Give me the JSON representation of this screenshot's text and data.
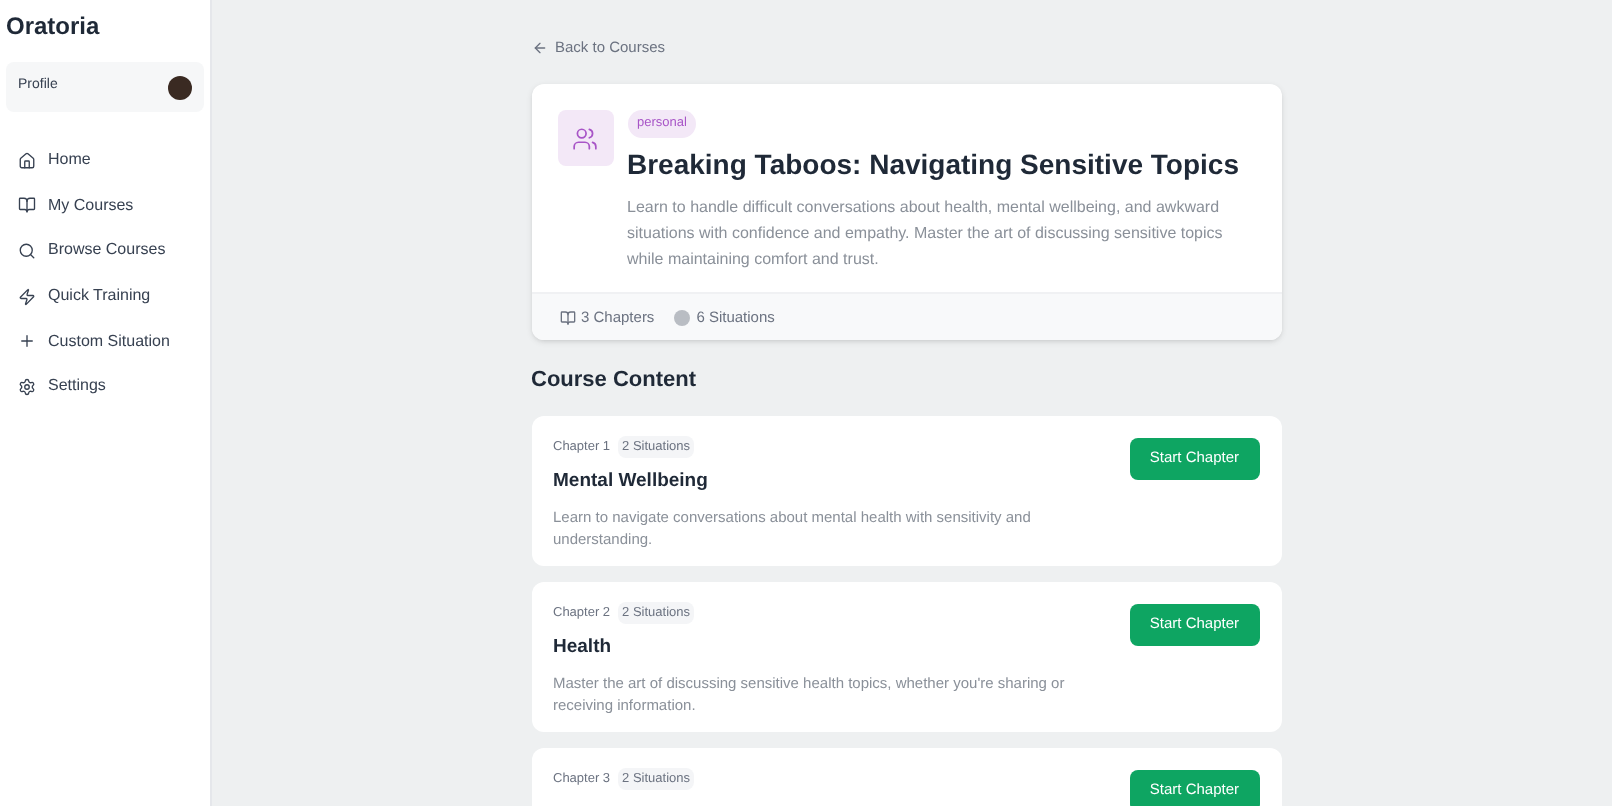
{
  "sidebar": {
    "brand": "Oratoria",
    "profile": {
      "label": "Profile"
    },
    "items": [
      {
        "label": "Home"
      },
      {
        "label": "My Courses"
      },
      {
        "label": "Browse Courses"
      },
      {
        "label": "Quick Training"
      },
      {
        "label": "Custom Situation"
      },
      {
        "label": "Settings"
      }
    ]
  },
  "back_link": "Back to Courses",
  "course": {
    "tag": "personal",
    "title": "Breaking Taboos: Navigating Sensitive Topics",
    "description": "Learn to handle difficult conversations about health, mental wellbeing, and awkward situations with confidence and empathy. Master the art of discussing sensitive topics while maintaining comfort and trust.",
    "chapters": "3 Chapters",
    "situations": "6 Situations"
  },
  "section_title": "Course Content",
  "chapters": [
    {
      "number": "Chapter 1",
      "situations": "2 Situations",
      "title": "Mental Wellbeing",
      "description": "Learn to navigate conversations about mental health with sensitivity and understanding.",
      "button": "Start Chapter"
    },
    {
      "number": "Chapter 2",
      "situations": "2 Situations",
      "title": "Health",
      "description": "Master the art of discussing sensitive health topics, whether you're sharing or receiving information.",
      "button": "Start Chapter"
    },
    {
      "number": "Chapter 3",
      "situations": "2 Situations",
      "button": "Start Chapter"
    }
  ]
}
